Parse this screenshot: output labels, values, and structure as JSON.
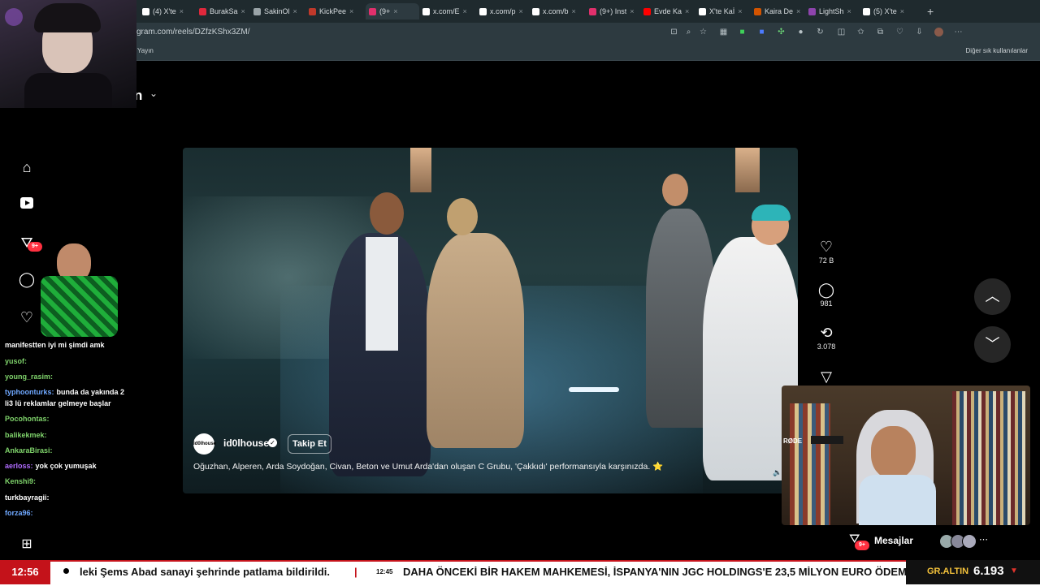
{
  "browser": {
    "tabs": [
      {
        "label": "(4) X'te",
        "color": "#ffffff"
      },
      {
        "label": "BurakSa",
        "color": "#e0283c"
      },
      {
        "label": "SakinOl",
        "color": "#9aa4a8"
      },
      {
        "label": "KickPee",
        "color": "#c0392b"
      },
      {
        "label": "(9+",
        "color": "#e1306c"
      },
      {
        "label": "x.com/E",
        "color": "#ffffff"
      },
      {
        "label": "x.com/p",
        "color": "#ffffff"
      },
      {
        "label": "x.com/b",
        "color": "#ffffff"
      },
      {
        "label": "(9+) Inst",
        "color": "#e1306c"
      },
      {
        "label": "Evde Ka",
        "color": "#ff0000"
      },
      {
        "label": "X'te Kaİ",
        "color": "#ffffff"
      },
      {
        "label": "Kaira De",
        "color": "#d35400"
      },
      {
        "label": "LightSh",
        "color": "#8e44ad"
      },
      {
        "label": "(5) X'te",
        "color": "#ffffff"
      }
    ],
    "tab_close": "×",
    "new_tab": "+",
    "url": "gram.com/reels/DZfzKShx3ZM/",
    "bookmark_left": "Yayın",
    "bookmark_right": "Diğer sık kullanılanlar"
  },
  "instagram": {
    "header_letter": "n",
    "video": {
      "author": "id0lhouse",
      "author_avatar_text": "id0lhouse",
      "follow_label": "Takip Et",
      "caption": "Oğuzhan, Alperen, Arda Soydoğan, Civan, Beton ve Umut Arda'dan oluşan C Grubu, 'Çakkıdı' performansıyla karşınızda. ⭐"
    },
    "actions": {
      "likes": "72 B",
      "comments": "981",
      "reposts": "3.078"
    },
    "notification_badge": "9+",
    "messages_label": "Mesajlar",
    "messages_badge": "9+"
  },
  "chat": [
    {
      "user": "manifestten iyi mi şimdi amk",
      "msg": "",
      "color": "#ffffff"
    },
    {
      "user": "yusof:",
      "msg": "",
      "color": "#7fd36b"
    },
    {
      "user": "young_rasim:",
      "msg": "",
      "color": "#7fd36b"
    },
    {
      "user": "typhoonturks:",
      "msg": "bunda da yakında 2",
      "color": "#6fa8ff"
    },
    {
      "user": "",
      "msg": "li3 lü reklamlar gelmeye başlar",
      "color": "#ffffff"
    },
    {
      "user": "Pocohontas:",
      "msg": "",
      "color": "#7fd36b"
    },
    {
      "user": "balikekmek:",
      "msg": "",
      "color": "#7fd36b"
    },
    {
      "user": "AnkaraBirasi:",
      "msg": "",
      "color": "#7fd36b"
    },
    {
      "user": "aerloss:",
      "msg": "yok çok yumuşak",
      "color": "#b06cff"
    },
    {
      "user": "Kenshi9:",
      "msg": "",
      "color": "#7fd36b"
    },
    {
      "user": "turkbayragii:",
      "msg": "",
      "color": "#ffffff"
    },
    {
      "user": "forza96:",
      "msg": "",
      "color": "#6fa8ff"
    }
  ],
  "ticker": {
    "time": "12:56",
    "news1": "leki Şems Abad sanayi şehrinde patlama bildirildi.",
    "separator": "|",
    "small_time": "12:45",
    "news2": "DAHA ÖNCEKİ BİR HAKEM MAHKEMESİ, İSPANYA'NIN JGC HOLDINGS'E 23,5 MİLYON EURO ÖDEMESİ",
    "gold_label": "GR.ALTIN",
    "gold_value": "6.193",
    "gold_trend": "▼"
  },
  "cam_mic_label": "RØDE"
}
